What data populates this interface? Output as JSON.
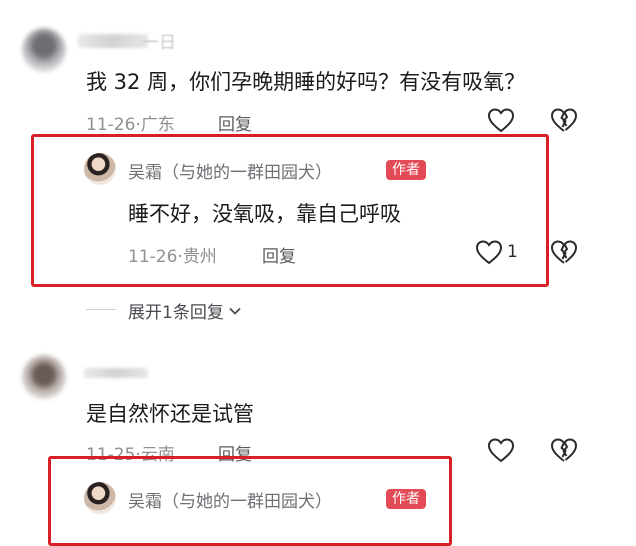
{
  "comment1": {
    "username": "一日",
    "text": "我 32 周，你们孕晚期睡的好吗？有没有吸氧？",
    "date": "11-26",
    "location": "广东",
    "reply_label": "回复"
  },
  "reply1": {
    "author_name": "吴霜（与她的一群田园犬）",
    "badge": "作者",
    "text": "睡不好，没氧吸，靠自己呼吸",
    "date": "11-26",
    "location": "贵州",
    "reply_label": "回复",
    "like_count": "1"
  },
  "expand_replies": "展开1条回复",
  "comment2": {
    "text": "是自然怀还是试管",
    "date": "11-25",
    "location": "云南",
    "reply_label": "回复"
  },
  "reply2": {
    "author_name": "吴霜（与她的一群田园犬）",
    "badge": "作者"
  },
  "icons": {
    "like": "heart-outline-icon",
    "dislike": "broken-heart-icon",
    "expand": "chevron-down-icon"
  },
  "colors": {
    "highlight_frame": "#d81f26",
    "author_badge": "#e24a55",
    "meta_text": "#8f8f94"
  }
}
